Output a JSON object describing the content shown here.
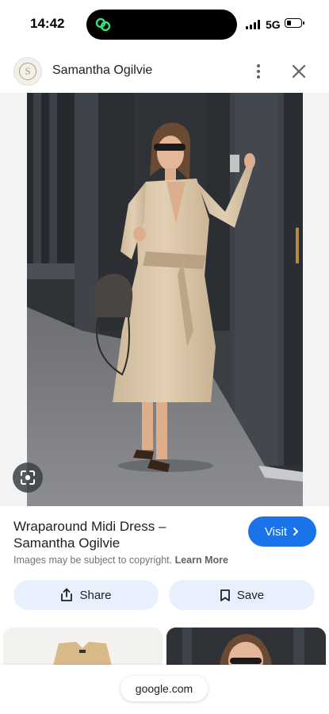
{
  "status_bar": {
    "time": "14:42",
    "network": "5G",
    "battery_level": 0.3
  },
  "header": {
    "site_name": "Samantha Ogilvie",
    "logo_letter": "S",
    "logo_icon": "site-logo-icon",
    "more_icon": "more-vert-icon",
    "close_icon": "close-icon"
  },
  "image": {
    "subject": "woman in beige wrap midi dress holding dark handbag",
    "lens_icon": "google-lens-icon"
  },
  "result": {
    "title": "Wraparound Midi Dress – Samantha Ogilvie",
    "visit_label": "Visit",
    "copyright_text": "Images may be subject to copyright.",
    "learn_more_label": "Learn More"
  },
  "actions": {
    "share_label": "Share",
    "save_label": "Save"
  },
  "bottom": {
    "url": "google.com"
  },
  "colors": {
    "accent": "#1a73e8",
    "action_bg": "#e8f0fe"
  }
}
